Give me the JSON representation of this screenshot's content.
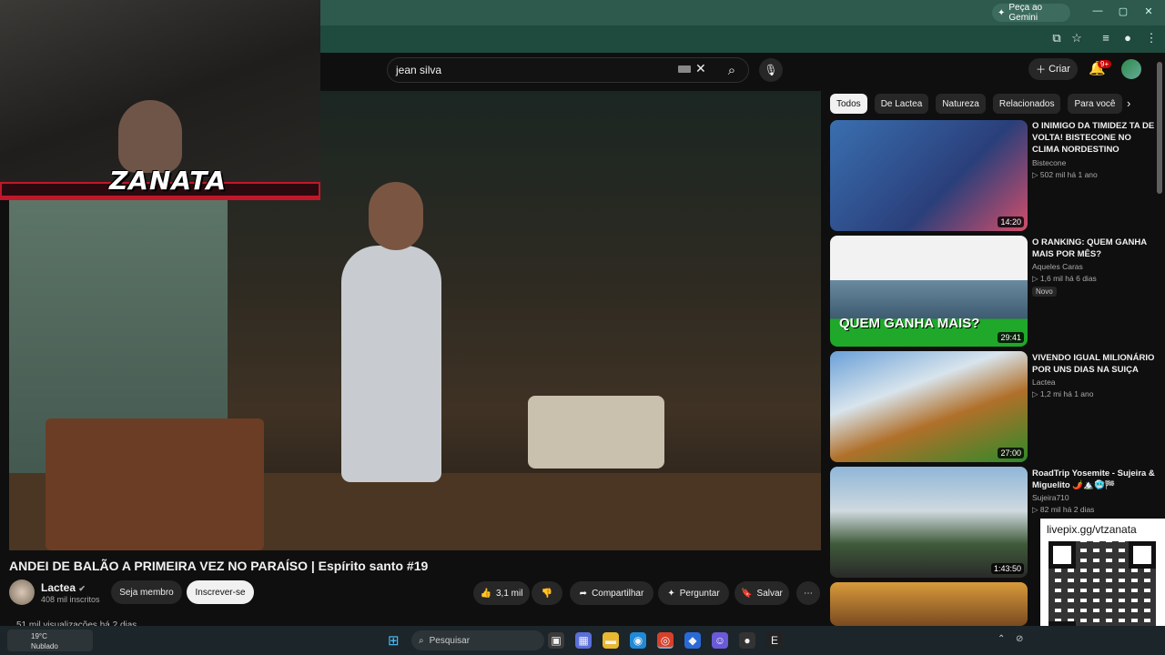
{
  "browser": {
    "gemini_label": "Peça ao Gemini",
    "win_controls": [
      "—",
      "▢",
      "✕"
    ]
  },
  "youtube_header": {
    "search_value": "jean silva",
    "create_label": "Criar",
    "notif_badge": "9+"
  },
  "webcam": {
    "overlay_name": "ZANATA"
  },
  "video": {
    "title": "ANDEI DE BALÃO A PRIMEIRA VEZ NO PARAÍSO | Espírito santo #19",
    "channel": "Lactea",
    "subs": "408 mil inscritos",
    "member_label": "Seja membro",
    "subscribe_label": "Inscrever-se",
    "likes": "3,1 mil",
    "share_label": "Compartilhar",
    "ask_label": "Perguntar",
    "save_label": "Salvar",
    "views_line": "51 mil visualizações  há 2 dias"
  },
  "chips": [
    "Todos",
    "De Lactea",
    "Natureza",
    "Relacionados",
    "Para você"
  ],
  "recommendations": [
    {
      "title": "O INIMIGO DA TIMIDEZ TA DE VOLTA! BISTECONE NO CLIMA NORDESTINO",
      "channel": "Bistecone",
      "meta": "▷ 502 mil  há 1 ano",
      "duration": "14:20"
    },
    {
      "title": "O RANKING: QUEM GANHA MAIS POR MÊS?",
      "channel": "Aqueles Caras",
      "meta": "▷ 1,6 mil  há 6 dias",
      "duration": "29:41",
      "badge": "Novo",
      "thumb_text": "QUEM GANHA MAIS?"
    },
    {
      "title": "VIVENDO IGUAL MILIONÁRIO POR UNS DIAS NA SUIÇA",
      "channel": "Lactea",
      "meta": "▷ 1,2 mi  há 1 ano",
      "duration": "27:00"
    },
    {
      "title": "RoadTrip Yosemite - Sujeira & Miguelito 🌶️🏔️🥶🏁",
      "channel": "Sujeira710",
      "meta": "▷ 82 mil  há 2 dias",
      "duration": "1:43:50"
    }
  ],
  "livepix": {
    "url": "livepix.gg/vtzanata"
  },
  "taskbar": {
    "temp": "19°C",
    "condition": "Nublado",
    "search_placeholder": "Pesquisar"
  }
}
